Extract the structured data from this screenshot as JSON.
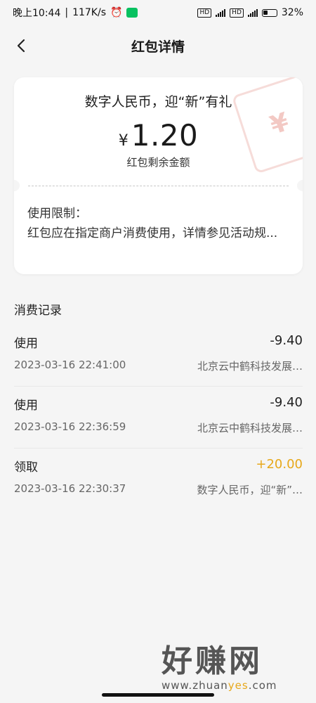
{
  "status_bar": {
    "time": "晚上10:44",
    "speed": "117K/s",
    "battery": "32%",
    "hd1": "HD",
    "hd2": "HD",
    "net1": "5G",
    "net2": "5G"
  },
  "header": {
    "title": "红包详情",
    "back_icon": "chevron-left-icon"
  },
  "card": {
    "promo_title": "数字人民币，迎“新”有礼",
    "currency_symbol": "¥",
    "amount": "1.20",
    "amount_label": "红包剩余金额",
    "limit_text": "使用限制：\n红包应在指定商户消费使用，详情参见活动规...",
    "stamp_glyph": "¥"
  },
  "records": {
    "title": "消费记录",
    "items": [
      {
        "type": "使用",
        "amount": "-9.40",
        "time": "2023-03-16 22:41:00",
        "merchant": "北京云中鹤科技发展…"
      },
      {
        "type": "使用",
        "amount": "-9.40",
        "time": "2023-03-16 22:36:59",
        "merchant": "北京云中鹤科技发展…"
      },
      {
        "type": "领取",
        "amount": "+20.00",
        "time": "2023-03-16 22:30:37",
        "merchant": "数字人民币，迎“新”…"
      }
    ]
  },
  "watermark": {
    "big": "好赚网",
    "small_prefix": "www.zhuan",
    "small_highlight": "yes",
    "small_suffix": ".com"
  },
  "colors": {
    "background": "#f5f5f5",
    "positive_amount": "#e7a81a",
    "wechat_green": "#07c160"
  }
}
